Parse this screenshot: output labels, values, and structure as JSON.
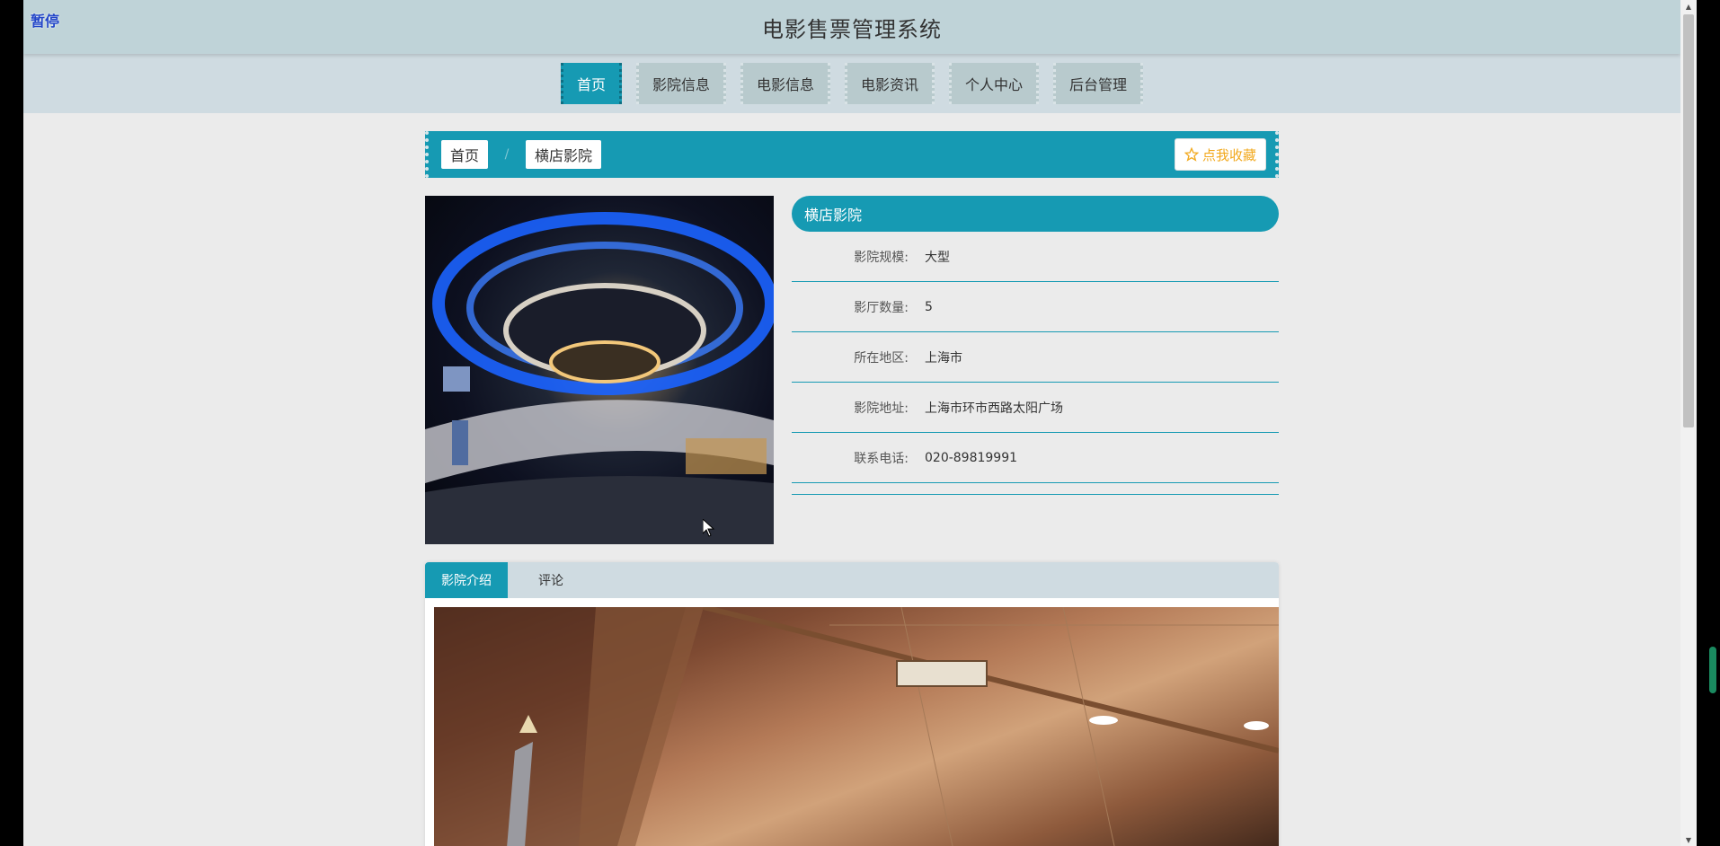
{
  "music_toggle": "暂停",
  "header": {
    "title": "电影售票管理系统"
  },
  "nav": {
    "items": [
      {
        "label": "首页",
        "active": true
      },
      {
        "label": "影院信息"
      },
      {
        "label": "电影信息"
      },
      {
        "label": "电影资讯"
      },
      {
        "label": "个人中心"
      },
      {
        "label": "后台管理"
      }
    ]
  },
  "breadcrumb": {
    "home": "首页",
    "separator": "/",
    "current": "横店影院"
  },
  "favorite": {
    "label": "点我收藏",
    "color": "#f2a91e"
  },
  "cinema": {
    "name": "横店影院",
    "fields": [
      {
        "label": "影院规模:",
        "value": "大型"
      },
      {
        "label": "影厅数量:",
        "value": "5"
      },
      {
        "label": "所在地区:",
        "value": "上海市"
      },
      {
        "label": "影院地址:",
        "value": "上海市环市西路太阳广场"
      },
      {
        "label": "联系电话:",
        "value": "020-89819991"
      }
    ]
  },
  "tabs": [
    {
      "label": "影院介绍",
      "active": true
    },
    {
      "label": "评论"
    }
  ],
  "theme": {
    "accent": "#169ab3",
    "header_bg": "#bfd3d8",
    "nav_bg": "#cfdbe1"
  }
}
